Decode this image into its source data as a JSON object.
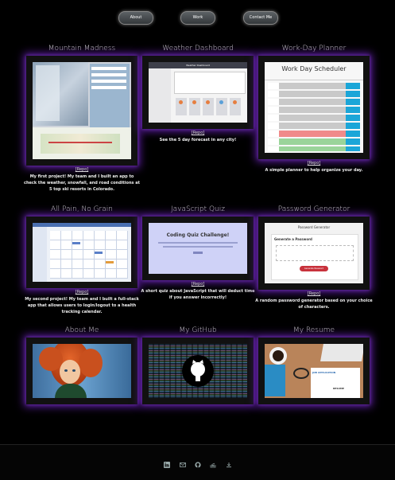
{
  "nav": {
    "about": "About",
    "work": "Work",
    "contact": "Contact Me"
  },
  "projects": [
    {
      "title": "Mountain Madness",
      "link": "[Repo]",
      "desc": "My first project! My team and I built an app to check the weather, snowfall, and road conditions at 5 top ski resorts in Colorado."
    },
    {
      "title": "Weather Dashboard",
      "link": "[Repo]",
      "desc": "See the 5 day forecast in any city!"
    },
    {
      "title": "Work-Day Planner",
      "link": "[Repo]",
      "desc": "A simple planner to help organize your day."
    },
    {
      "title": "All Pain, No Grain",
      "link": "[Repo]",
      "desc": "My second project! My team and I built a full-stack app that allows users to login/logout to a health tracking calendar."
    },
    {
      "title": "JavaScript Quiz",
      "link": "[Repo]",
      "desc": "A short quiz about JavaScript that will deduct time if you answer incorrectly!"
    },
    {
      "title": "Password Generator",
      "link": "[Repo]",
      "desc": "A random password generator based on your choice of characters."
    },
    {
      "title": "About Me"
    },
    {
      "title": "My GitHub"
    },
    {
      "title": "My Resume"
    }
  ],
  "screens": {
    "weather_header": "Weather Dashboard",
    "planner_header": "Work Day Scheduler",
    "quiz_header": "Coding Quiz Challenge!",
    "password_header": "Password Generator",
    "password_label": "Generate a Password",
    "password_button": "Generate Password",
    "resume_doc": "JOB APPLICATION",
    "resume_doc2": "RESUME"
  },
  "footer_icons": [
    "linkedin-icon",
    "email-icon",
    "github-icon",
    "stack-icon",
    "download-icon"
  ],
  "colors": {
    "glow": "#5a1d9c",
    "background": "#000000"
  }
}
